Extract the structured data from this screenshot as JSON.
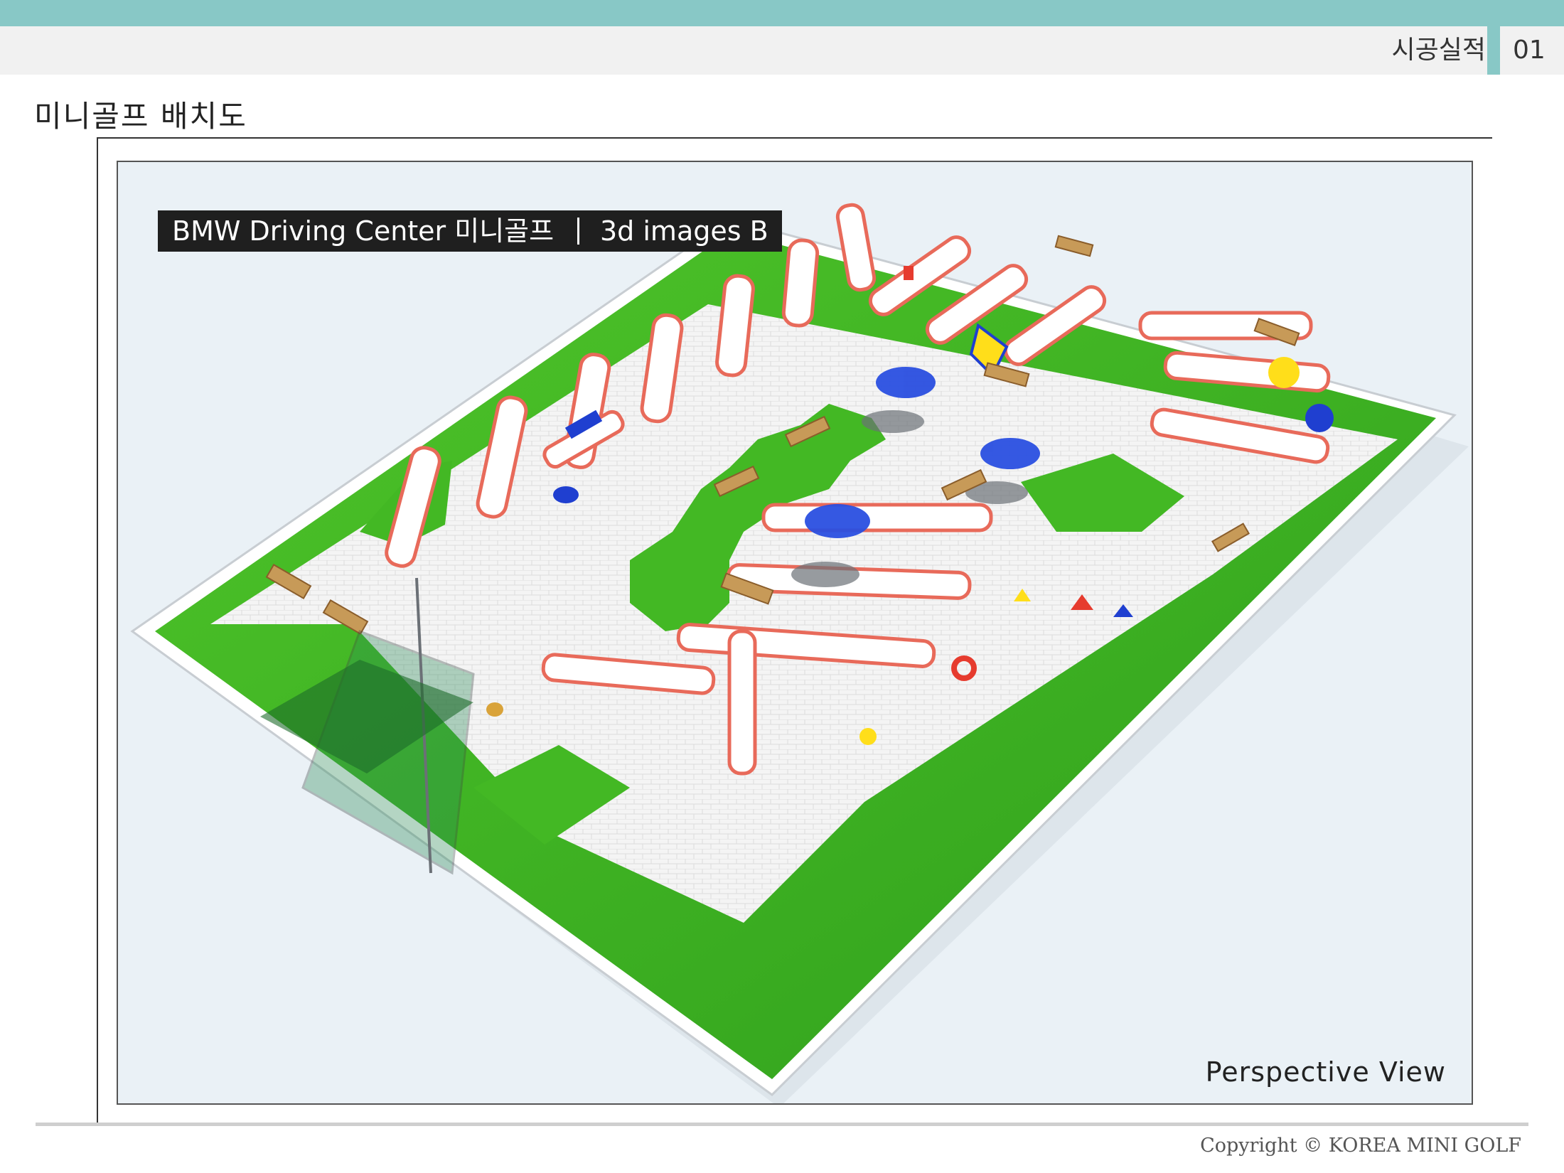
{
  "header": {
    "section_label": "시공실적",
    "page_number": "01",
    "accent_color": "#88c8c6"
  },
  "page": {
    "title": "미니골프 배치도"
  },
  "figure": {
    "banner_left": "BMW Driving Center 미니골프",
    "banner_right": "3d images B",
    "view_label": "Perspective View"
  },
  "footer": {
    "copyright": "Copyright © KOREA MINI GOLF"
  }
}
